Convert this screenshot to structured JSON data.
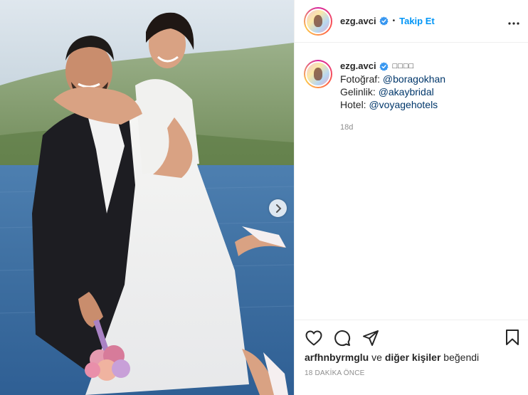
{
  "post": {
    "author": {
      "username": "ezg.avci",
      "verified": true,
      "follow_label": "Takip Et",
      "separator": "•"
    },
    "caption": {
      "username": "ezg.avci",
      "emoji_placeholder": "□□□□",
      "lines": [
        {
          "label": "Fotoğraf: ",
          "mention": "@boragokhan"
        },
        {
          "label": "Gelinlik: ",
          "mention": "@akaybridal"
        },
        {
          "label": "Hotel: ",
          "mention": "@voyagehotels"
        }
      ],
      "time_ago": "18d"
    },
    "likes": {
      "user": "arfhnbyrmglu",
      "connector": " ve ",
      "others": "diğer kişiler",
      "suffix": " beğendi"
    },
    "posted_ago": "18 DAKİKA ÖNCE"
  },
  "colors": {
    "accent": "#0095f6",
    "mention": "#00376b",
    "muted": "#8e8e8e",
    "verified": "#3897f0"
  },
  "icons": {
    "verified": "verified-badge-icon",
    "more": "more-options-icon",
    "next": "chevron-right-icon",
    "like": "heart-icon",
    "comment": "comment-icon",
    "share": "paper-plane-icon",
    "save": "bookmark-icon"
  }
}
